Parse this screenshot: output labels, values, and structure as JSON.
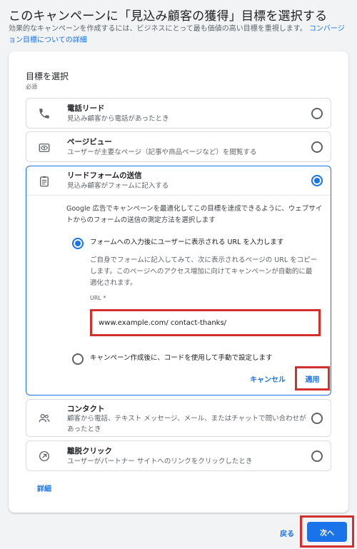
{
  "header": {
    "title": "このキャンペーンに「見込み顧客の獲得」目標を選択する",
    "subtitle": "効果的なキャンペーンを作成するには、ビジネスにとって最も価値の高い目標を重視します。",
    "subtitle_link": "コンバージョン目標についての詳細"
  },
  "goal_section": {
    "title": "目標を選択",
    "required": "必須"
  },
  "options": [
    {
      "title": "電話リード",
      "desc": "見込み顧客から電話があったとき",
      "icon": "phone-icon",
      "selected": false
    },
    {
      "title": "ページビュー",
      "desc": "ユーザーが主要なページ（記事や商品ページなど）を閲覧する",
      "icon": "eye-icon",
      "selected": false
    },
    {
      "title": "リードフォームの送信",
      "desc": "見込み顧客がフォームに記入する",
      "icon": "form-icon",
      "selected": true
    },
    {
      "title": "コンタクト",
      "desc": "顧客から電話、テキスト メッセージ、メール、またはチャットで問い合わせがあったとき",
      "icon": "contacts-icon",
      "selected": false
    },
    {
      "title": "離脱クリック",
      "desc": "ユーザーがパートナー サイトへのリンクをクリックしたとき",
      "icon": "outbound-icon",
      "selected": false
    }
  ],
  "lead_form": {
    "intro": "Google 広告でキャンペーンを最適化してこの目標を達成できるように、ウェブサイトからのフォームの送信の測定方法を選択します",
    "method1": {
      "label": "フォームへの入力後にユーザーに表示される URL を入力します",
      "desc": "ご自身でフォームに記入してみて、次に表示されるページの URL をコピーします。このページへのアクセス増加に向けてキャンペーンが自動的に最適化されます。",
      "selected": true
    },
    "url_label": "URL *",
    "url_value": "www.example.com/ contact-thanks/",
    "method2": {
      "label": "キャンペーン作成後に、コードを使用して手動で設定します",
      "selected": false
    },
    "cancel": "キャンセル",
    "apply": "適用"
  },
  "details_link": "詳細",
  "footer": {
    "back": "戻る",
    "next": "次へ"
  },
  "colors": {
    "accent": "#1a73e8",
    "highlight": "#d32f2f",
    "background": "#f1f3f4"
  }
}
